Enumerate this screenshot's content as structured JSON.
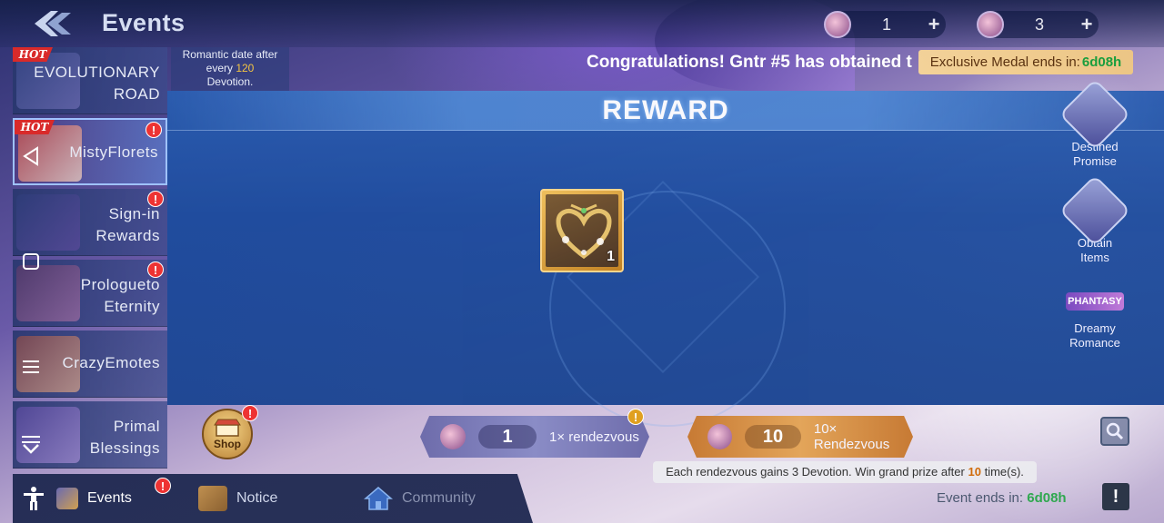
{
  "header": {
    "title": "Events",
    "currencies": [
      {
        "value": "1",
        "plus": "+",
        "icon": "rose-currency-icon"
      },
      {
        "value": "3",
        "plus": "+",
        "icon": "rose-token-icon"
      }
    ]
  },
  "romantic_note": {
    "line1": "Romantic date after",
    "line2": "every",
    "amount": "120",
    "line3": "Devotion."
  },
  "announcement": "Congratulations! Gntr #5 has obtained t",
  "medal_banner": {
    "label": "Exclusive Medal ends in:",
    "time": "6d08h"
  },
  "sidebar": {
    "items": [
      {
        "label1": "EVOLUTIONARY",
        "label2": "ROAD",
        "hot": "HOT",
        "alert": ""
      },
      {
        "label1": "MistyFlorets",
        "label2": "",
        "hot": "HOT",
        "alert": "!"
      },
      {
        "label1": "Sign-in",
        "label2": "Rewards",
        "hot": "",
        "alert": "!"
      },
      {
        "label1": "Prologueto",
        "label2": "Eternity",
        "hot": "",
        "alert": "!"
      },
      {
        "label1": "CrazyEmotes",
        "label2": "",
        "hot": "",
        "alert": ""
      },
      {
        "label1": "Primal",
        "label2": "Blessings",
        "hot": "",
        "alert": ""
      }
    ]
  },
  "reward": {
    "title": "REWARD",
    "item_qty": "1",
    "item_icon": "heart-frame-icon"
  },
  "side_events": [
    {
      "label1": "Destined",
      "label2": "Promise"
    },
    {
      "label1": "Obtain",
      "label2": "Items"
    },
    {
      "label1": "Dreamy",
      "label2": "Romance",
      "badge": "PHANTASY"
    }
  ],
  "shop": {
    "label": "Shop",
    "alert": "!"
  },
  "rendezvous": [
    {
      "count": "1",
      "label": "1× rendezvous",
      "alert": "!"
    },
    {
      "count": "10",
      "label": "10× Rendezvous"
    }
  ],
  "tooltip": {
    "pre": "Each rendezvous gains 3 Devotion. Win grand prize after",
    "times": "10",
    "post": "time(s)."
  },
  "bottom_nav": {
    "tabs": [
      {
        "label": "Events",
        "alert": "!"
      },
      {
        "label": "Notice"
      },
      {
        "label": "Community"
      }
    ]
  },
  "event_end": {
    "label": "Event ends in:",
    "time": "6d08h"
  },
  "info_label": "!",
  "colors": {
    "accent_gold": "#f4c542",
    "timer_green": "#1a9e3e",
    "alert_red": "#e33333",
    "panel_blue": "#1e4c9e"
  }
}
